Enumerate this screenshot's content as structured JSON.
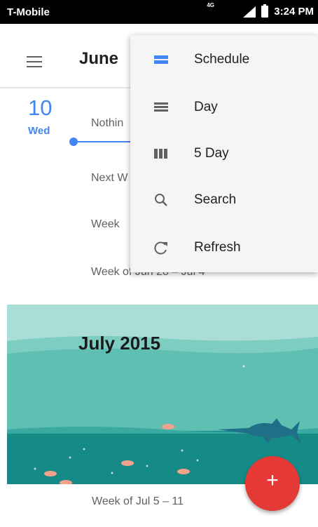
{
  "status_bar": {
    "carrier": "T-Mobile",
    "network": "4G",
    "time": "3:24 PM"
  },
  "app_bar": {
    "month_title": "June"
  },
  "agenda": {
    "date_number": "10",
    "date_weekday": "Wed",
    "items": [
      "Nothin",
      "Next W",
      "Week",
      "Week of Jun 28 – Jul 4"
    ]
  },
  "banner": {
    "title": "July 2015"
  },
  "week_bottom": "Week of Jul 5 – 11",
  "fab": {
    "label": "+"
  },
  "menu": {
    "items": [
      {
        "label": "Schedule",
        "icon": "schedule-icon"
      },
      {
        "label": "Day",
        "icon": "day-icon"
      },
      {
        "label": "5 Day",
        "icon": "five-day-icon"
      },
      {
        "label": "Search",
        "icon": "search-icon"
      },
      {
        "label": "Refresh",
        "icon": "refresh-icon"
      }
    ]
  },
  "colors": {
    "accent": "#4285f4",
    "fab": "#e53935",
    "sea": "#4fb8aa"
  }
}
